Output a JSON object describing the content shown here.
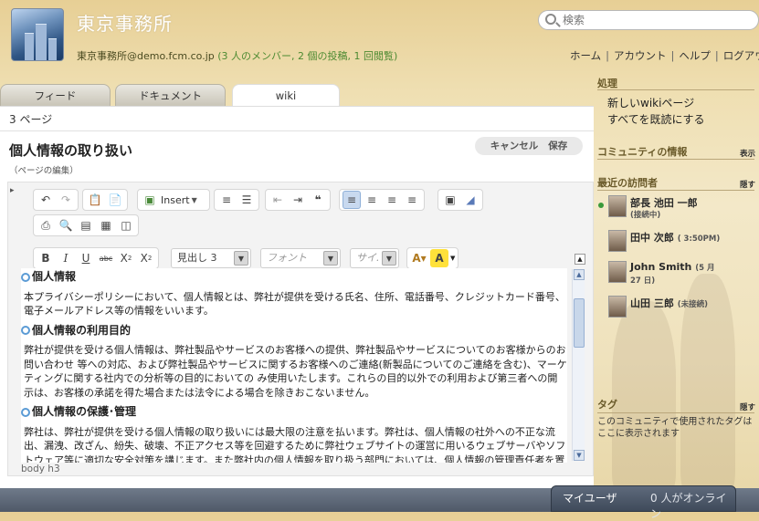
{
  "header": {
    "title": "東京事務所",
    "email": "東京事務所@demo.fcm.co.jp",
    "stats": "(3 人のメンバー, 2 個の投稿, 1 回閲覧)",
    "search_placeholder": "検索"
  },
  "topnav": [
    "ホーム",
    "アカウント",
    "ヘルプ",
    "ログアウト"
  ],
  "tabs": [
    "フィード",
    "ドキュメント",
    "wiki"
  ],
  "main": {
    "page_count": "3 ページ",
    "page_title": "個人情報の取り扱い",
    "page_edit": "（ページの編集）",
    "cancel": "キャンセル",
    "save": "保存"
  },
  "toolbar": {
    "insert": "Insert",
    "heading_select": "見出し 3",
    "font_select": "フォント",
    "size_select": "サイ."
  },
  "content": {
    "h1": "個人情報",
    "p1": "本プライバシーポリシーにおいて、個人情報とは、弊社が提供を受ける氏名、住所、電話番号、クレジットカード番号、電子メールアドレス等の情報をいいます。",
    "h2": "個人情報の利用目的",
    "p2": "弊社が提供を受ける個人情報は、弊社製品やサービスのお客様への提供、弊社製品やサービスについてのお客様からのお問い合わせ 等への対応、および弊社製品やサービスに関するお客様へのご連絡(新製品についてのご連絡を含む)、マーケティングに関する社内での分析等の目的においての み使用いたします。これらの目的以外での利用および第三者への開示は、お客様の承諾を得た場合または法令による場合を除きおこないません。",
    "h3": "個人情報の保護･管理",
    "p3": "弊社は、弊社が提供を受ける個人情報の取り扱いには最大限の注意を払います。弊社は、個人情報の社外への不正な流出、漏洩、改ざん、紛失、破壊、不正アクセス等を回避するために弊社ウェブサイトの運営に用いるウェブサーバやソフトウェア等に適切な安全対策を講じます。また弊社内の個人情報を取り扱う部門においては、個人情報の管理責任者を置き、個人情報の適切な管理に努めます。"
  },
  "statusbar": "body  h3",
  "sidebar": {
    "process_head": "処理",
    "new_wiki": "新しいwikiページ",
    "mark_all_read": "すべてを既読にする",
    "community_info": "コミュニティの情報",
    "show": "表示",
    "recent_visitors": "最近の訪問者",
    "hide": "隠す",
    "visitors": [
      {
        "name": "部長 池田 一郎",
        "note": "(接続中)",
        "online": true
      },
      {
        "name": "田中 次郎",
        "note": "( 3:50PM)",
        "online": false
      },
      {
        "name": "John Smith",
        "note": "(5 月",
        "note2": "27 日)",
        "online": false
      },
      {
        "name": "山田 三郎",
        "note": "(未接続)",
        "online": false
      }
    ],
    "tags_head": "タグ",
    "tags_hide": "隠す",
    "tags_text": "このコミュニティで使用されたタグはここに表示されます"
  },
  "bottom": {
    "myuser": "マイユーザ",
    "online": "0 人がオンライン"
  }
}
